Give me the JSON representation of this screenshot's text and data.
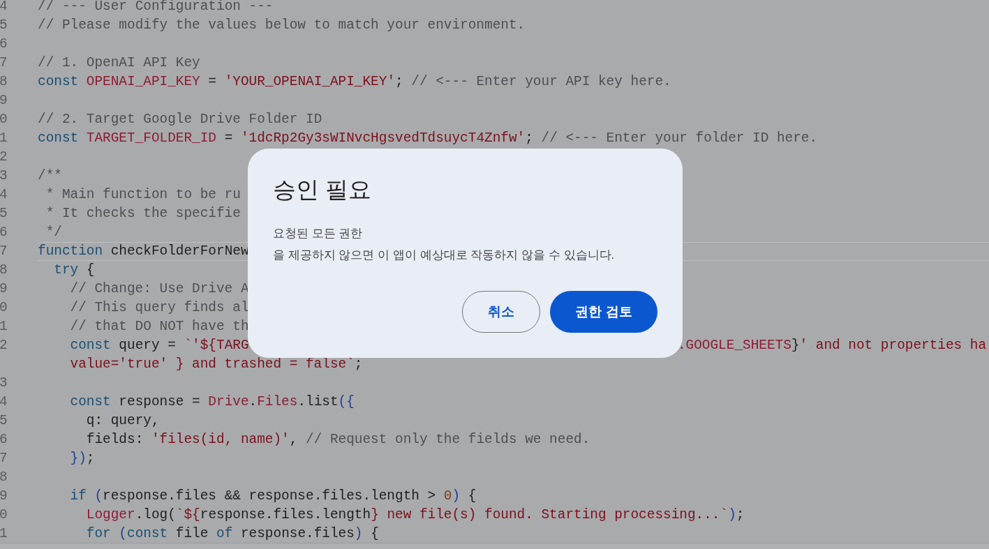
{
  "editor": {
    "lines": [
      {
        "number": "4",
        "current": false,
        "segments": [
          [
            {
              "kind": "comment",
              "text": "// --- User Configuration ---"
            }
          ]
        ]
      },
      {
        "number": "5",
        "current": false,
        "segments": [
          [
            {
              "kind": "comment",
              "text": "// Please modify the values below to match your environment."
            }
          ]
        ]
      },
      {
        "number": "6",
        "current": false
      },
      {
        "number": "7",
        "current": false,
        "segments": [
          [
            {
              "kind": "comment",
              "text": "// 1. OpenAI API Key"
            }
          ]
        ]
      },
      {
        "number": "8",
        "current": false,
        "segments": [
          [
            {
              "kind": "keyword",
              "text": "const"
            },
            {
              "kind": "constant",
              "text": " OPENAI_API_KEY"
            },
            {
              "kind": "plain",
              "text": " = "
            },
            {
              "kind": "string",
              "text": "'YOUR_OPENAI_API_KEY'"
            },
            {
              "kind": "plain",
              "text": "; "
            },
            {
              "kind": "comment",
              "text": "// <--- Enter your API key here."
            }
          ]
        ]
      },
      {
        "number": "9",
        "current": false
      },
      {
        "number": "0",
        "current": false,
        "segments": [
          [
            {
              "kind": "comment",
              "text": "// 2. Target Google Drive Folder ID"
            }
          ]
        ]
      },
      {
        "number": "1",
        "current": false,
        "segments": [
          [
            {
              "kind": "keyword",
              "text": "const"
            },
            {
              "kind": "constant",
              "text": " TARGET_FOLDER_ID"
            },
            {
              "kind": "plain",
              "text": " = "
            },
            {
              "kind": "string",
              "text": "'1dcRp2Gy3sWINvcHgsvedTdsuycT4Znfw'"
            },
            {
              "kind": "plain",
              "text": "; "
            },
            {
              "kind": "comment",
              "text": "// <--- Enter your folder ID here."
            }
          ]
        ]
      },
      {
        "number": "2",
        "current": false
      },
      {
        "number": "3",
        "current": false,
        "segments": [
          [
            {
              "kind": "comment",
              "text": "/**"
            }
          ]
        ]
      },
      {
        "number": "4",
        "current": false,
        "segments": [
          [
            {
              "kind": "comment",
              "text": " * Main function to be ru"
            }
          ]
        ]
      },
      {
        "number": "5",
        "current": false,
        "segments": [
          [
            {
              "kind": "comment",
              "text": " * It checks the specifie"
            }
          ]
        ]
      },
      {
        "number": "6",
        "current": false,
        "segments": [
          [
            {
              "kind": "comment",
              "text": " */"
            }
          ]
        ]
      },
      {
        "number": "7",
        "current": true,
        "segments": [
          [
            {
              "kind": "keyword",
              "text": "function"
            },
            {
              "kind": "plain",
              "text": " checkFolderForNew"
            }
          ]
        ]
      },
      {
        "number": "8",
        "current": false,
        "segments": [
          [
            {
              "kind": "keyword",
              "text": "  try"
            },
            {
              "kind": "plain",
              "text": " {"
            }
          ]
        ]
      },
      {
        "number": "9",
        "current": false,
        "segments": [
          [
            {
              "kind": "comment",
              "text": "    // Change: Use Drive A"
            }
          ]
        ]
      },
      {
        "number": "0",
        "current": false,
        "segments": [
          [
            {
              "kind": "comment",
              "text": "    // This query finds al"
            }
          ]
        ]
      },
      {
        "number": "1",
        "current": false,
        "segments": [
          [
            {
              "kind": "comment",
              "text": "    // that DO NOT have th"
            }
          ]
        ]
      },
      {
        "number": "2",
        "current": false,
        "segments": [
          [
            {
              "kind": "keyword",
              "text": "    const"
            },
            {
              "kind": "plain",
              "text": " query = "
            },
            {
              "kind": "string",
              "text": "`'${TARG"
            }
          ],
          [
            {
              "kind": "constant",
              "text": ".GOOGLE_SHEETS"
            },
            {
              "kind": "plain",
              "text": "}"
            },
            {
              "kind": "string",
              "text": "' and not properties ha"
            }
          ]
        ]
      },
      {
        "current": false,
        "segments": [
          [
            {
              "kind": "string",
              "text": "    value='true' } and trashed = false`"
            },
            {
              "kind": "plain",
              "text": ";"
            }
          ]
        ]
      },
      {
        "number": "3",
        "current": false
      },
      {
        "number": "4",
        "current": false,
        "segments": [
          [
            {
              "kind": "keyword",
              "text": "    const"
            },
            {
              "kind": "plain",
              "text": " response = "
            },
            {
              "kind": "constant",
              "text": "Drive"
            },
            {
              "kind": "plain",
              "text": "."
            },
            {
              "kind": "constant",
              "text": "Files"
            },
            {
              "kind": "plain",
              "text": ".list"
            },
            {
              "kind": "punct",
              "text": "({"
            }
          ]
        ]
      },
      {
        "number": "5",
        "current": false,
        "segments": [
          [
            {
              "kind": "plain",
              "text": "      q: query,"
            }
          ]
        ]
      },
      {
        "number": "6",
        "current": false,
        "segments": [
          [
            {
              "kind": "plain",
              "text": "      fields: "
            },
            {
              "kind": "string",
              "text": "'files(id, name)'"
            },
            {
              "kind": "plain",
              "text": ", "
            },
            {
              "kind": "comment",
              "text": "// Request only the fields we need."
            }
          ]
        ]
      },
      {
        "number": "7",
        "current": false,
        "segments": [
          [
            {
              "kind": "punct",
              "text": "    })"
            },
            {
              "kind": "plain",
              "text": ";"
            }
          ]
        ]
      },
      {
        "number": "8",
        "current": false
      },
      {
        "number": "9",
        "current": false,
        "segments": [
          [
            {
              "kind": "keyword",
              "text": "    if"
            },
            {
              "kind": "punct",
              "text": " ("
            },
            {
              "kind": "plain",
              "text": "response.files && response.files.length > "
            },
            {
              "kind": "number",
              "text": "0"
            },
            {
              "kind": "punct",
              "text": ")"
            },
            {
              "kind": "plain",
              "text": " {"
            }
          ]
        ]
      },
      {
        "number": "0",
        "current": false,
        "segments": [
          [
            {
              "kind": "constant",
              "text": "      Logger"
            },
            {
              "kind": "plain",
              "text": ".log("
            },
            {
              "kind": "string",
              "text": "`${"
            },
            {
              "kind": "plain",
              "text": "response.files.length"
            },
            {
              "kind": "string",
              "text": "} new file(s) found. Starting processing...`"
            },
            {
              "kind": "punct",
              "text": ")"
            },
            {
              "kind": "plain",
              "text": ";"
            }
          ]
        ]
      },
      {
        "number": "1",
        "current": false,
        "segments": [
          [
            {
              "kind": "keyword",
              "text": "      for"
            },
            {
              "kind": "punct",
              "text": " ("
            },
            {
              "kind": "keyword",
              "text": "const"
            },
            {
              "kind": "plain",
              "text": " file "
            },
            {
              "kind": "keyword",
              "text": "of"
            },
            {
              "kind": "plain",
              "text": " response.files"
            },
            {
              "kind": "punct",
              "text": ")"
            },
            {
              "kind": "plain",
              "text": " {"
            }
          ]
        ]
      }
    ]
  },
  "dialog": {
    "title": "승인 필요",
    "message": "요청된 모든 권한\n을 제공하지 않으면 이 앱이 예상대로 작동하지 않을 수 있습니다.",
    "buttons": [
      {
        "label": "취소",
        "kind": "secondary"
      },
      {
        "label": "권한 검토",
        "kind": "primary"
      }
    ]
  }
}
